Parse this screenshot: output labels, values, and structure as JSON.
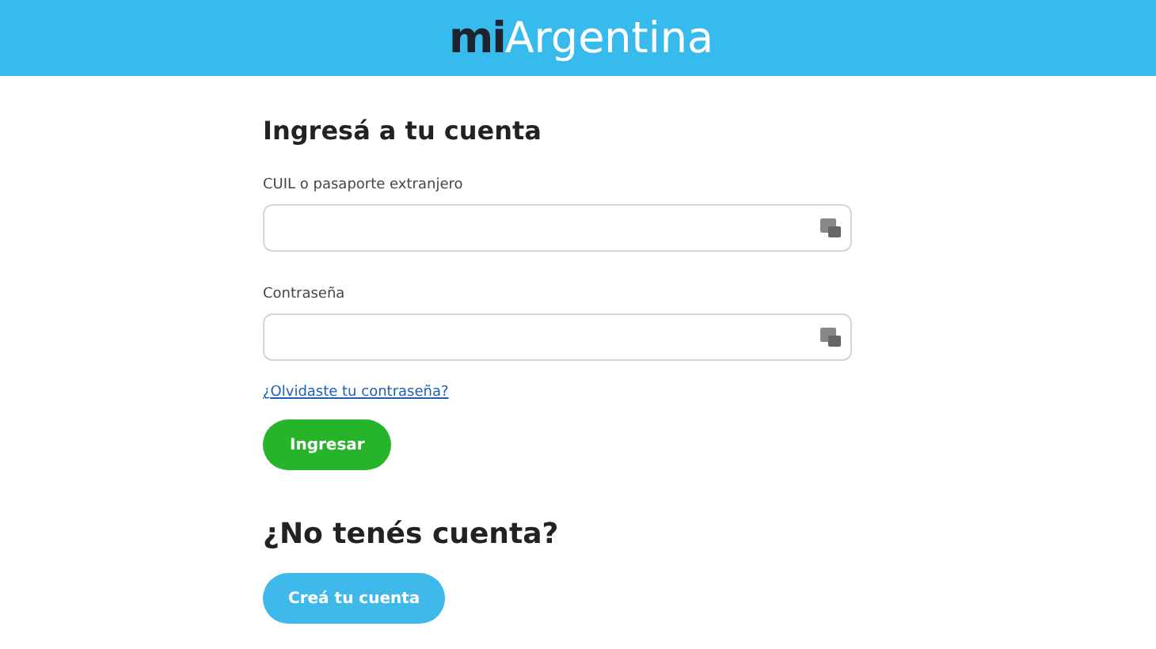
{
  "header": {
    "logo_prefix": "mi",
    "logo_name": "Argentina"
  },
  "login": {
    "title": "Ingresá a tu cuenta",
    "fields": [
      {
        "label": "CUIL o pasaporte extranjero"
      },
      {
        "label": "Contraseña"
      }
    ],
    "forgot_link": "¿Olvidaste tu contraseña?",
    "submit": "Ingresar"
  },
  "register": {
    "title": "¿No tenés cuenta?",
    "button": "Creá tu cuenta"
  }
}
